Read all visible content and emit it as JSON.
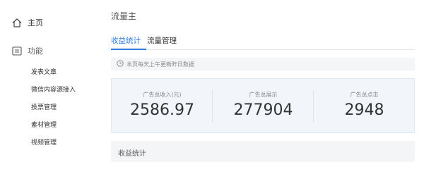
{
  "sidebar": {
    "home_label": "主页",
    "features_label": "功能",
    "items": [
      {
        "label": "发表文章"
      },
      {
        "label": "微信内容源接入"
      },
      {
        "label": "投票管理"
      },
      {
        "label": "素材管理"
      },
      {
        "label": "视频管理"
      }
    ]
  },
  "main": {
    "title": "流量主",
    "tabs": [
      {
        "label": "收益统计",
        "active": true
      },
      {
        "label": "流量管理",
        "active": false
      }
    ],
    "notice": "本页每天上午更新昨日数据",
    "stats": [
      {
        "label": "广告总收入(元)",
        "value": "2586.97"
      },
      {
        "label": "广告总展示",
        "value": "277904"
      },
      {
        "label": "广告总点击",
        "value": "2948"
      }
    ],
    "section_title": "收益统计"
  },
  "colors": {
    "accent": "#2f7de1",
    "stats_bg": "#f2f6fb",
    "notice_bg": "#f4f5f6"
  }
}
